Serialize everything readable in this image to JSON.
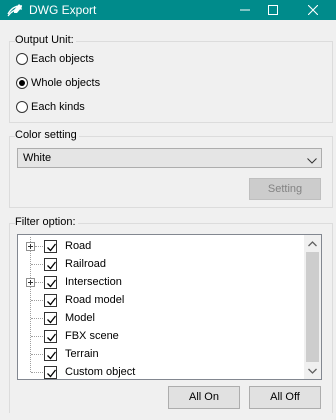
{
  "window": {
    "title": "DWG Export",
    "icon": "pen-icon",
    "title_bar_color": "#008b8b",
    "controls": [
      "minimize",
      "maximize",
      "close"
    ]
  },
  "output_unit": {
    "label": "Output Unit:",
    "options": [
      {
        "label": "Each objects",
        "checked": false
      },
      {
        "label": "Whole objects",
        "checked": true
      },
      {
        "label": "Each kinds",
        "checked": false
      }
    ]
  },
  "color_setting": {
    "label": "Color setting",
    "selected": "White",
    "setting_button": "Setting",
    "setting_enabled": false
  },
  "filter": {
    "label": "Filter option:",
    "items": [
      {
        "label": "Road",
        "checked": true,
        "expandable": true
      },
      {
        "label": "Railroad",
        "checked": true,
        "expandable": false
      },
      {
        "label": "Intersection",
        "checked": true,
        "expandable": true
      },
      {
        "label": "Road model",
        "checked": true,
        "expandable": false
      },
      {
        "label": "Model",
        "checked": true,
        "expandable": false
      },
      {
        "label": "FBX scene",
        "checked": true,
        "expandable": false
      },
      {
        "label": "Terrain",
        "checked": true,
        "expandable": false
      },
      {
        "label": "Custom object",
        "checked": true,
        "expandable": false
      }
    ]
  },
  "buttons": {
    "all_on": "All On",
    "all_off": "All Off"
  }
}
